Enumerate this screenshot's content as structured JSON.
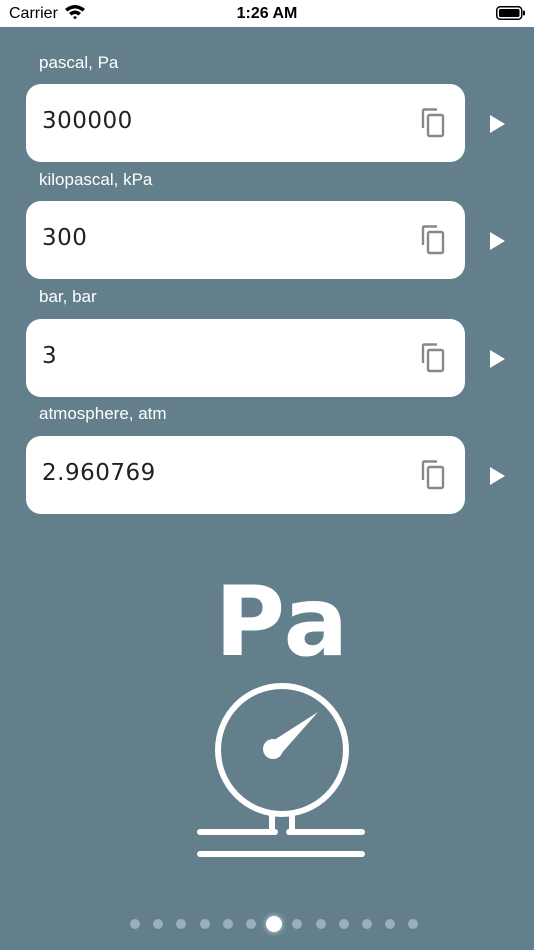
{
  "status_bar": {
    "carrier": "Carrier",
    "time": "1:26 AM"
  },
  "fields": [
    {
      "label": "pascal, Pa",
      "value": "300000"
    },
    {
      "label": "kilopascal, kPa",
      "value": "300"
    },
    {
      "label": "bar, bar",
      "value": "3"
    },
    {
      "label": "atmosphere, atm",
      "value": "2.960769"
    }
  ],
  "unit_symbol": "Pa",
  "pager": {
    "total": 13,
    "current": 7
  },
  "colors": {
    "background": "#637f8c",
    "card": "#ffffff",
    "accent": "#ffffff"
  },
  "icons": {
    "copy": "copy-icon",
    "arrow": "play-arrow-icon",
    "gauge": "pressure-gauge-icon"
  }
}
